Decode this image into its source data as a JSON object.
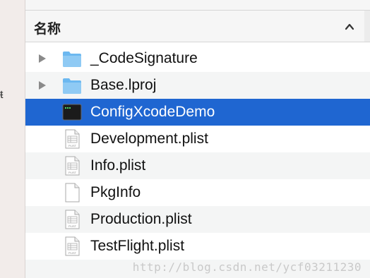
{
  "sidebar": {
    "glyph": "ŧ"
  },
  "header": {
    "column_label": "名称",
    "sort_icon": "chevron-up-icon"
  },
  "files": [
    {
      "name": "_CodeSignature",
      "icon": "folder-icon",
      "expandable": true
    },
    {
      "name": "Base.lproj",
      "icon": "folder-icon",
      "expandable": true
    },
    {
      "name": "ConfigXcodeDemo",
      "icon": "terminal-executable-icon",
      "expandable": false,
      "selected": true
    },
    {
      "name": "Development.plist",
      "icon": "plist-file-icon",
      "expandable": false
    },
    {
      "name": "Info.plist",
      "icon": "plist-file-icon",
      "expandable": false
    },
    {
      "name": "PkgInfo",
      "icon": "blank-file-icon",
      "expandable": false
    },
    {
      "name": "Production.plist",
      "icon": "plist-file-icon",
      "expandable": false
    },
    {
      "name": "TestFlight.plist",
      "icon": "plist-file-icon",
      "expandable": false
    }
  ],
  "plist_icon_label": "PLIST",
  "watermark": "http://blog.csdn.net/ycf03211230",
  "colors": {
    "selection": "#1f66d1",
    "folder": "#6cb8f0",
    "row_alt": "#f4f5f5"
  }
}
